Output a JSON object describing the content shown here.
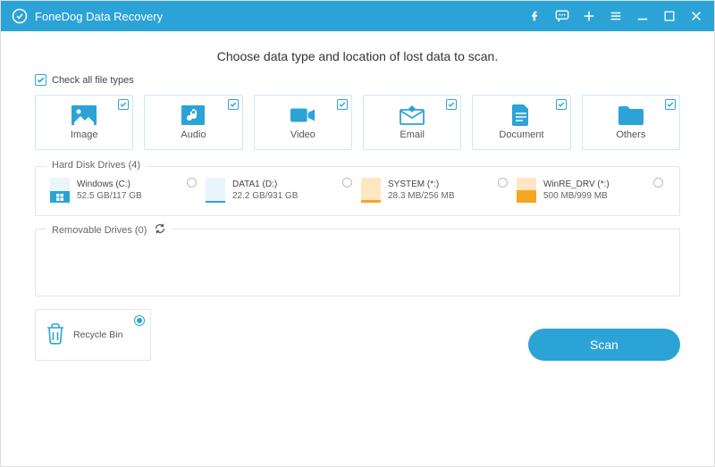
{
  "titlebar": {
    "app_name": "FoneDog Data Recovery"
  },
  "heading": "Choose data type and location of lost data to scan.",
  "check_all_label": "Check all file types",
  "types": {
    "image": "Image",
    "audio": "Audio",
    "video": "Video",
    "email": "Email",
    "document": "Document",
    "others": "Others"
  },
  "sections": {
    "hdd_legend": "Hard Disk Drives (4)",
    "removable_legend": "Removable Drives (0)"
  },
  "drives": {
    "d0_name": "Windows (C:)",
    "d0_size": "52.5 GB/117 GB",
    "d1_name": "DATA1 (D:)",
    "d1_size": "22.2 GB/931 GB",
    "d2_name": "SYSTEM (*:)",
    "d2_size": "28.3 MB/256 MB",
    "d3_name": "WinRE_DRV (*:)",
    "d3_size": "500 MB/999 MB"
  },
  "recycle": {
    "label": "Recycle Bin"
  },
  "scan_label": "Scan",
  "colors": {
    "accent": "#2ca3d6",
    "orange": "#f5a623"
  }
}
